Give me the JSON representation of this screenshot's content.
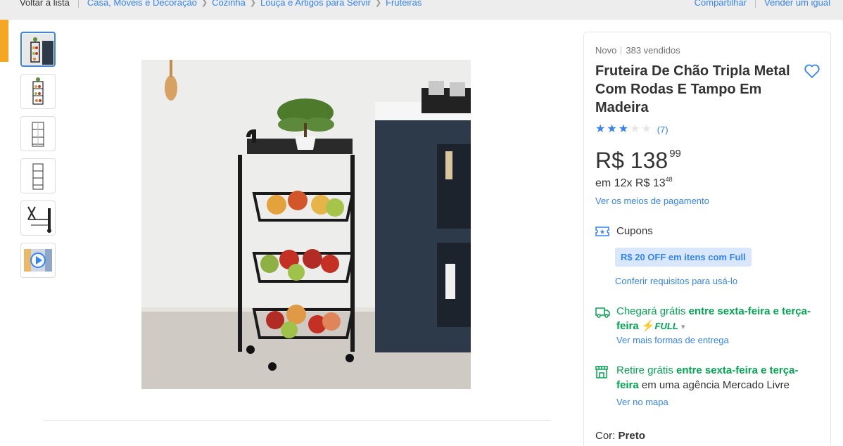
{
  "breadcrumb": {
    "back": "Voltar à lista",
    "items": [
      "Casa, Móveis e Decoração",
      "Cozinha",
      "Louça e Artigos para Servir",
      "Fruteiras"
    ]
  },
  "header_actions": {
    "share": "Compartilhar",
    "sell": "Vender um igual"
  },
  "gallery": {
    "thumbnails": [
      "product-photo",
      "front-view",
      "wireframe-view",
      "side-view",
      "detail-view",
      "video"
    ],
    "selected_index": 0
  },
  "product": {
    "condition": "Novo",
    "sold": "383 vendidos",
    "title": "Fruteira De Chão Tripla Metal Com Rodas E Tampo Em Madeira",
    "rating": {
      "stars": 3,
      "max": 5,
      "count": "(7)"
    },
    "price": {
      "currency": "R$",
      "integer": "138",
      "cents": "99"
    },
    "installments": {
      "prefix": "em 12x R$ 13",
      "cents": "48"
    },
    "payment_link": "Ver os meios de pagamento",
    "coupons": {
      "label": "Cupons",
      "badge": "R$ 20 OFF em itens com Full",
      "link": "Conferir requisitos para usá-lo"
    },
    "shipping": {
      "prefix": "Chegará grátis",
      "bold": "entre sexta-feira e terça-feira",
      "full_label": "FULL",
      "link": "Ver mais formas de entrega"
    },
    "pickup": {
      "prefix": "Retire grátis",
      "bold": "entre sexta-feira e terça-feira",
      "suffix": "em uma agência Mercado Livre",
      "link": "Ver no mapa"
    },
    "color": {
      "label": "Cor:",
      "value": "Preto"
    }
  },
  "colors": {
    "accent": "#3483fa",
    "green": "#00a650",
    "badge_bg": "#d9e7fd",
    "orange": "#f5a623"
  }
}
